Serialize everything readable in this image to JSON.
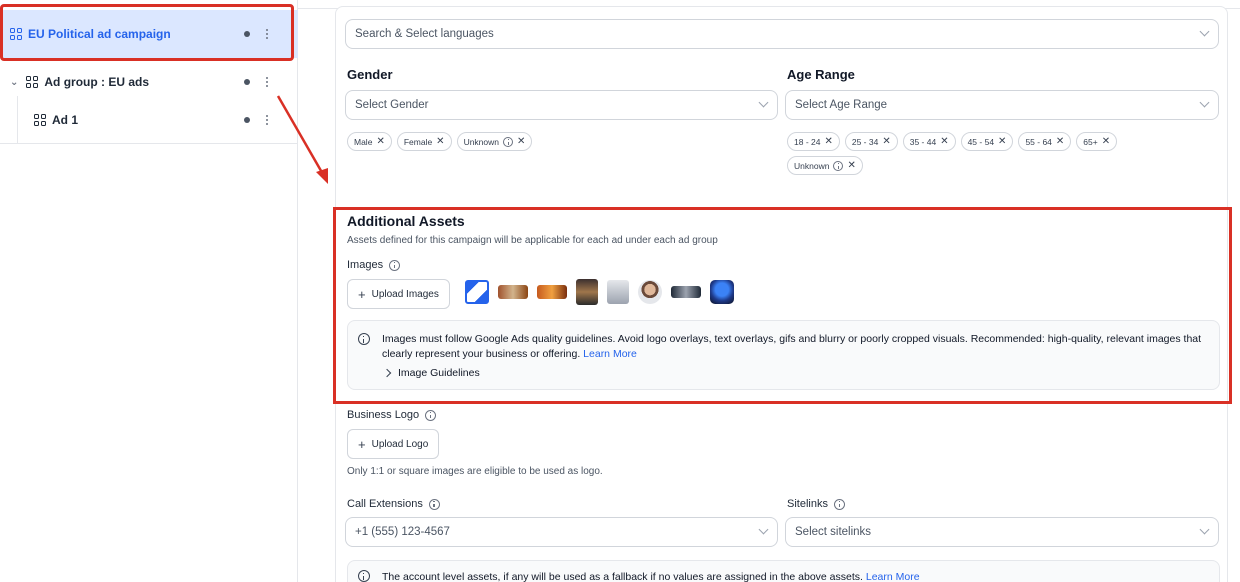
{
  "sidebar": {
    "items": [
      {
        "label": "EU Political ad campaign"
      },
      {
        "label": "Ad group : EU ads"
      },
      {
        "label": "Ad 1"
      }
    ]
  },
  "languages": {
    "placeholder": "Search & Select languages"
  },
  "gender": {
    "label": "Gender",
    "placeholder": "Select Gender",
    "chips": [
      "Male",
      "Female",
      "Unknown"
    ]
  },
  "age_range": {
    "label": "Age Range",
    "placeholder": "Select Age Range",
    "chips": [
      "18 - 24",
      "25 - 34",
      "35 - 44",
      "45 - 54",
      "55 - 64",
      "65+",
      "Unknown"
    ]
  },
  "additional_assets": {
    "title": "Additional Assets",
    "subtitle": "Assets defined for this campaign will be applicable for each ad under each ad group",
    "images_label": "Images",
    "upload_images": "Upload Images",
    "notice_text": "Images must follow Google Ads quality guidelines. Avoid logo overlays, text overlays, gifs and blurry or poorly cropped visuals. Recommended: high-quality, relevant images that clearly represent your business or offering.",
    "learn_more": "Learn More",
    "guidelines": "Image Guidelines"
  },
  "business_logo": {
    "label": "Business Logo",
    "upload": "Upload Logo",
    "hint": "Only 1:1 or square images are eligible to be used as logo."
  },
  "call_extensions": {
    "label": "Call Extensions",
    "value": "+1 (555) 123-4567"
  },
  "sitelinks": {
    "label": "Sitelinks",
    "placeholder": "Select sitelinks"
  },
  "fallback_notice": {
    "text": "The account level assets, if any will be used as a fallback if no values are assigned in the above assets.",
    "learn_more": "Learn More"
  },
  "colors": {
    "accent": "#2563eb",
    "highlight": "#d93025",
    "selected_bg": "#dbe7ff"
  }
}
